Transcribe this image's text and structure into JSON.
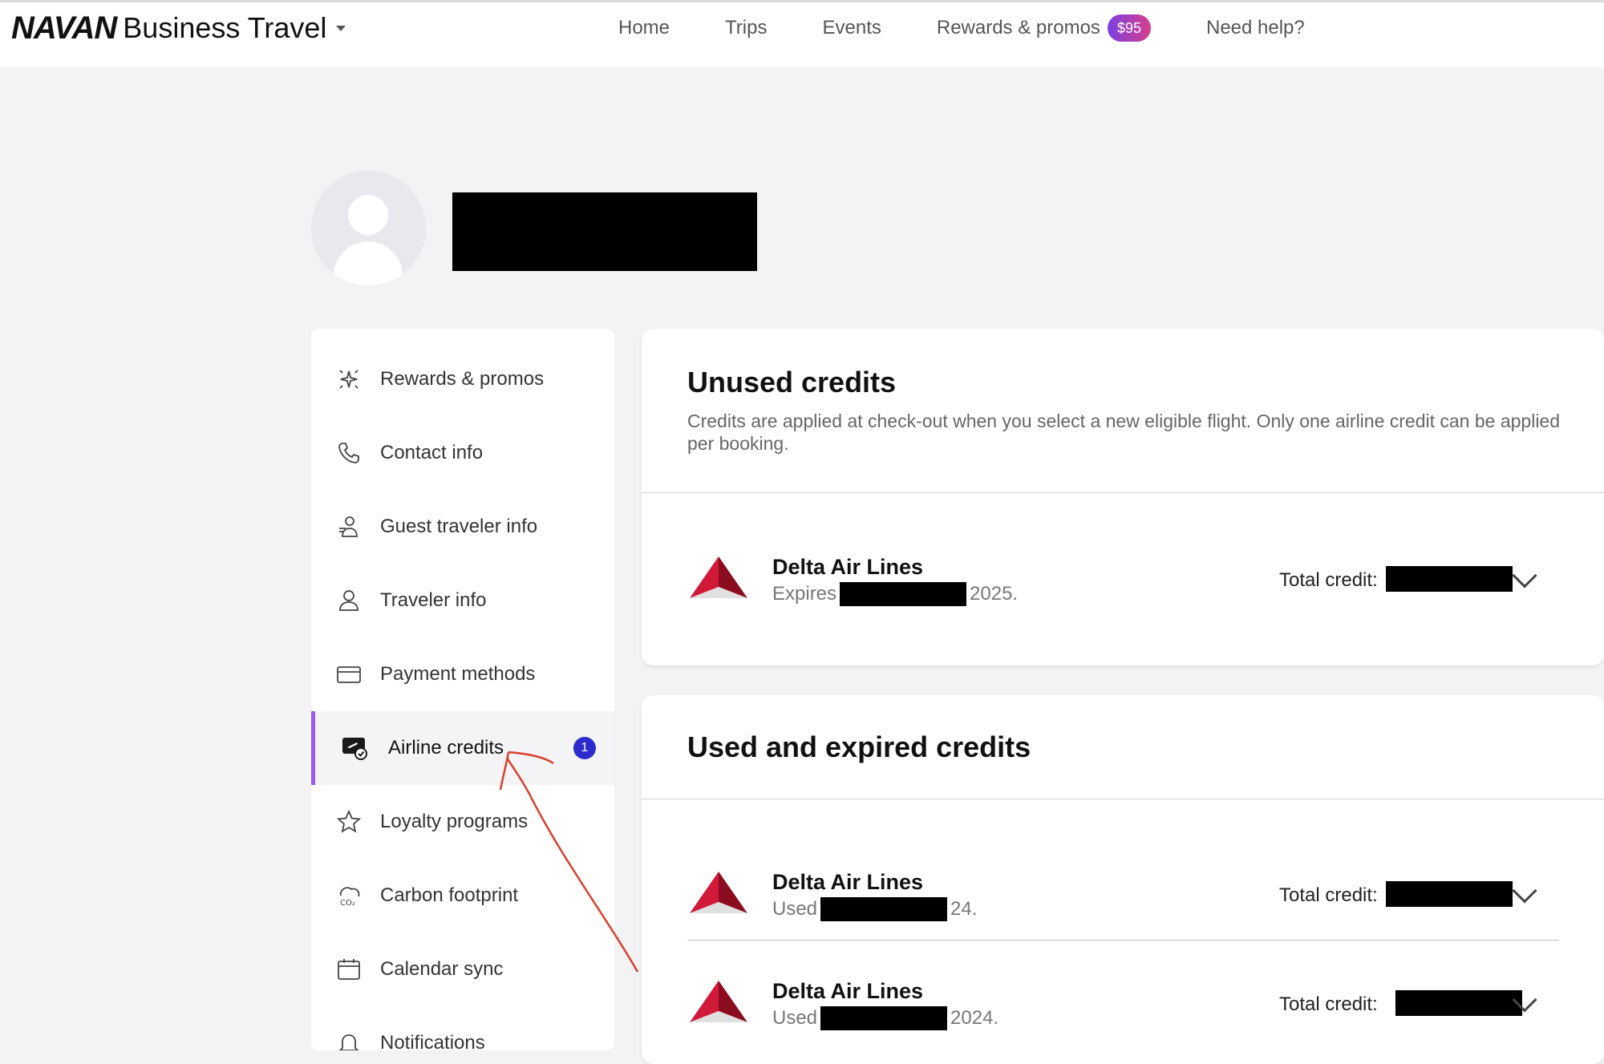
{
  "topnav": {
    "brand_logo": "NAVAN",
    "brand_product": "Business Travel",
    "links": {
      "home": "Home",
      "trips": "Trips",
      "events": "Events",
      "rewards": "Rewards & promos",
      "rewards_badge": "$95",
      "help": "Need help?"
    }
  },
  "sidebar": {
    "items": {
      "rewards": "Rewards & promos",
      "contact": "Contact info",
      "guest": "Guest traveler info",
      "traveler": "Traveler info",
      "payment": "Payment methods",
      "airline_credits": "Airline credits",
      "airline_credits_count": "1",
      "loyalty": "Loyalty programs",
      "carbon": "Carbon footprint",
      "calendar": "Calendar sync",
      "notifications": "Notifications"
    },
    "icons": {
      "rewards": "sparkle-icon",
      "contact": "phone-icon",
      "guest": "guest-traveler-icon",
      "traveler": "person-icon",
      "payment": "credit-card-icon",
      "airline_credits": "airline-credit-icon",
      "loyalty": "star-icon",
      "carbon": "co2-cloud-icon",
      "calendar": "calendar-icon",
      "notifications": "bell-icon"
    }
  },
  "unused": {
    "title": "Unused credits",
    "description": "Credits are applied at check-out when you select a new eligible flight. Only one airline credit can be applied per booking.",
    "credits": [
      {
        "airline": "Delta Air Lines",
        "status": "Expires",
        "suffix": "2025.",
        "total_label": "Total credit:"
      }
    ]
  },
  "used": {
    "title": "Used and expired credits",
    "credits": [
      {
        "airline": "Delta Air Lines",
        "status": "Used",
        "suffix": "24.",
        "total_label": "Total credit:"
      },
      {
        "airline": "Delta Air Lines",
        "status": "Used",
        "suffix": "2024.",
        "total_label": "Total credit:"
      }
    ]
  },
  "colors": {
    "accent": "#9b5cf2",
    "badge_blue": "#2c2ccc",
    "delta_red": "#c8102e",
    "annotation_red": "#d9402b"
  }
}
